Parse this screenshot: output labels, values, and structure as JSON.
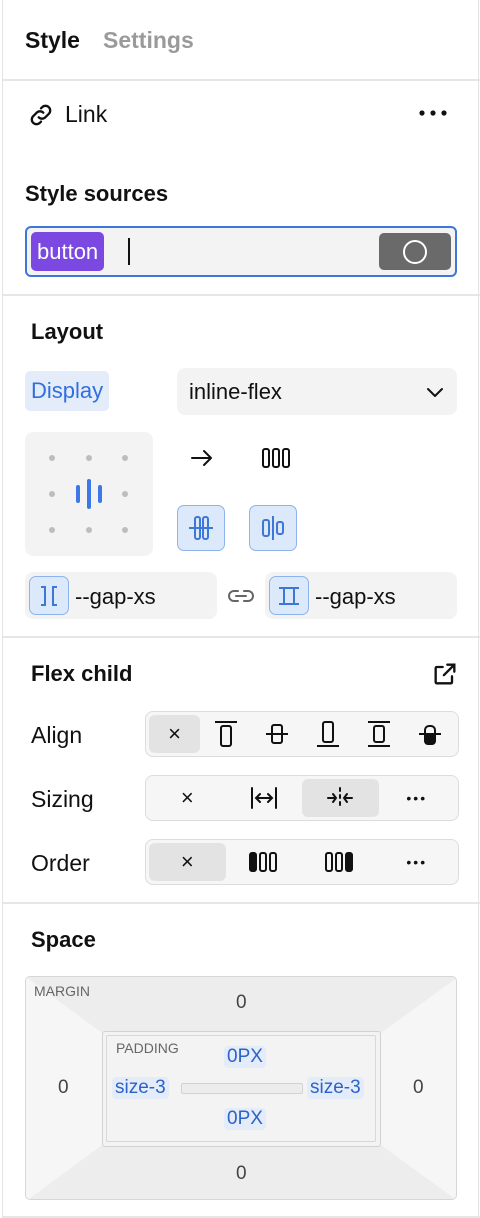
{
  "tabs": {
    "style": "Style",
    "settings": "Settings"
  },
  "link": {
    "label": "Link",
    "icon": "link-icon",
    "more": "more-horizontal-icon"
  },
  "style_sources": {
    "title": "Style sources",
    "token": "button",
    "accent": "#7b48e2"
  },
  "layout": {
    "title": "Layout",
    "display_label": "Display",
    "display_value": "inline-flex",
    "gap_column": "--gap-xs",
    "gap_row": "--gap-xs"
  },
  "flex_child": {
    "title": "Flex child",
    "align_label": "Align",
    "sizing_label": "Sizing",
    "order_label": "Order",
    "x": "×",
    "more": "•••"
  },
  "space": {
    "title": "Space",
    "margin_label": "MARGIN",
    "padding_label": "PADDING",
    "margin_top": "0",
    "margin_right": "0",
    "margin_bottom": "0",
    "margin_left": "0",
    "padding_top": "0PX",
    "padding_right": "size-3",
    "padding_bottom": "0PX",
    "padding_left": "size-3"
  },
  "colors": {
    "blue": "#2f6fe0",
    "token_purple": "#7b48e2",
    "input_border": "#3d77d8"
  }
}
